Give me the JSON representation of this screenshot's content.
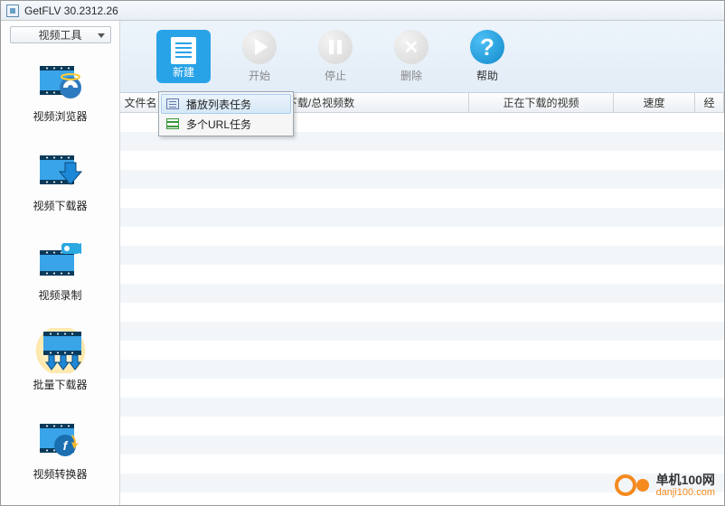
{
  "window": {
    "title": "GetFLV 30.2312.26"
  },
  "sidebar": {
    "header": "视频工具",
    "items": [
      {
        "label": "视频浏览器"
      },
      {
        "label": "视频下载器"
      },
      {
        "label": "视频录制"
      },
      {
        "label": "批量下载器"
      },
      {
        "label": "视频转换器"
      }
    ]
  },
  "toolbar": {
    "new": "新建",
    "start": "开始",
    "stop": "停止",
    "delete": "删除",
    "help": "帮助"
  },
  "columns": {
    "filename": "文件名",
    "downloaded": "已下载/总视频数",
    "downloading": "正在下载的视频",
    "speed": "速度",
    "elapsed": "经"
  },
  "dropdown": {
    "playlist": "播放列表任务",
    "multiurl": "多个URL任务"
  },
  "watermark": {
    "name": "单机100网",
    "url": "danji100.com"
  }
}
